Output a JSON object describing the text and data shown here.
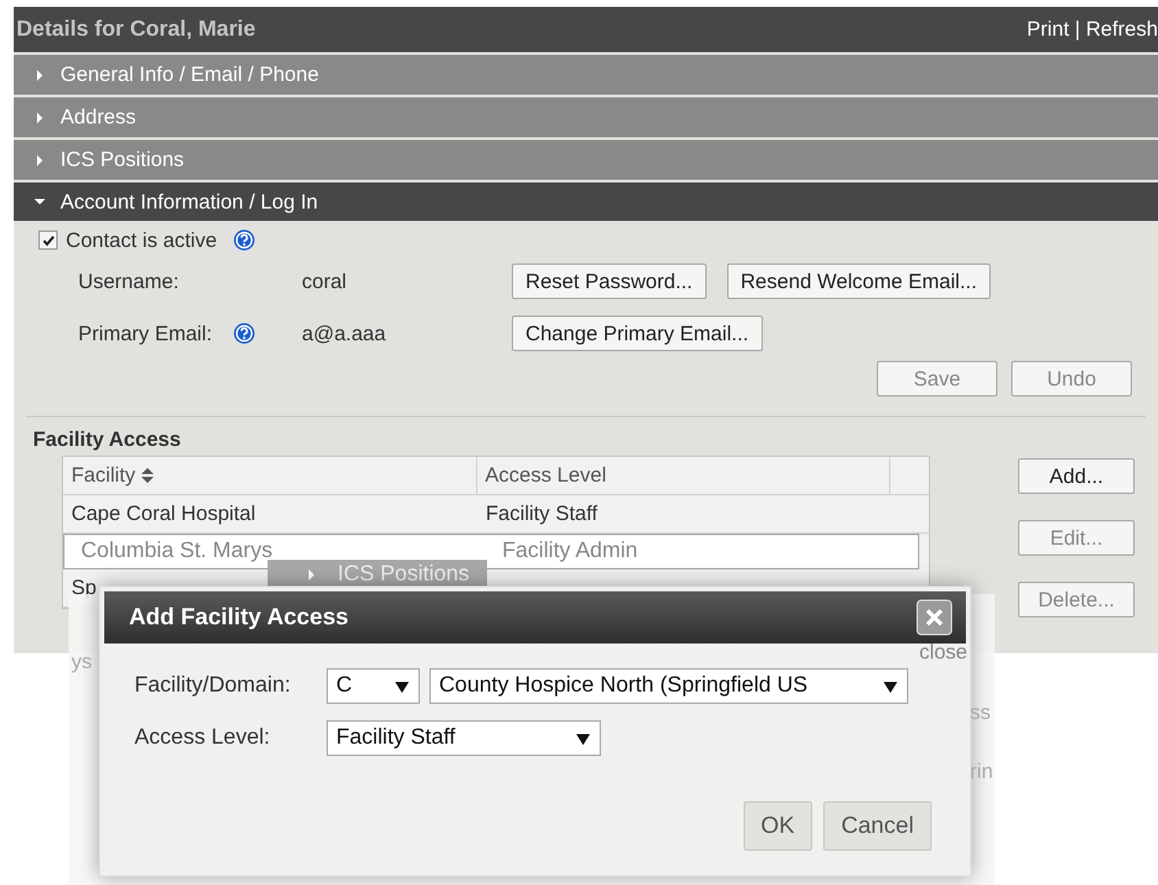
{
  "header": {
    "title": "Details for Coral, Marie",
    "links": "Print | Refresh"
  },
  "sections": [
    {
      "label": "General Info / Email / Phone",
      "expanded": false
    },
    {
      "label": "Address",
      "expanded": false
    },
    {
      "label": "ICS Positions",
      "expanded": false
    },
    {
      "label": "Account Information / Log In",
      "expanded": true
    }
  ],
  "account": {
    "active": {
      "label": "Contact is active",
      "checked": true
    },
    "fields": [
      {
        "label": "Username:",
        "value": "coral",
        "help": false,
        "buttons": [
          {
            "label": "Reset Password...",
            "disabled": false
          },
          {
            "label": "Resend Welcome Email...",
            "disabled": false
          }
        ]
      },
      {
        "label": "Primary Email:",
        "value": "a@a.aaa",
        "help": true,
        "buttons": [
          {
            "label": "Change Primary Email...",
            "disabled": false
          }
        ]
      }
    ],
    "actions": [
      {
        "label": "Save",
        "disabled": true
      },
      {
        "label": "Undo",
        "disabled": true
      }
    ]
  },
  "facility_access": {
    "title": "Facility Access",
    "columns": [
      {
        "label": "Facility",
        "sortable": true
      },
      {
        "label": "Access Level",
        "sortable": false
      }
    ],
    "rows": [
      {
        "cells": [
          "Cape Coral Hospital",
          "Facility Staff"
        ],
        "selected": false
      },
      {
        "cells": [
          "Columbia St. Marys",
          "Facility Admin"
        ],
        "selected": true
      },
      {
        "cells": [
          "Sp"
        ],
        "selected": false
      }
    ],
    "buttons": [
      {
        "label": "Add...",
        "disabled": false
      },
      {
        "label": "Edit...",
        "disabled": true
      },
      {
        "label": "Delete...",
        "disabled": true
      }
    ]
  },
  "ghost": {
    "bar_label": "ICS Positions",
    "fragments": [
      "close",
      "ys",
      "ss",
      "rin"
    ]
  },
  "dialog": {
    "title": "Add Facility Access",
    "fields": [
      {
        "label": "Facility/Domain:",
        "selects": [
          "C",
          "County Hospice North (Springfield US"
        ]
      },
      {
        "label": "Access Level:",
        "selects": [
          "Facility Staff"
        ]
      }
    ],
    "buttons": [
      "OK",
      "Cancel"
    ]
  }
}
